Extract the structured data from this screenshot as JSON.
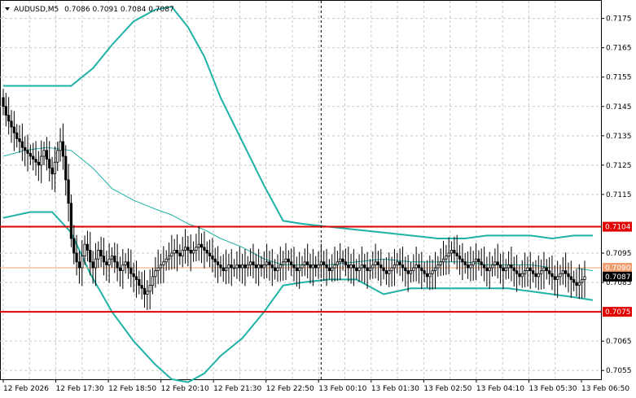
{
  "header": {
    "symbol": "AUDUSD,M5",
    "ohlc": "0.7086 0.7091 0.7084 0.7087"
  },
  "colors": {
    "grid": "#c8c8c8",
    "candle": "#000000",
    "bands": "#1fb2a6",
    "level_red": "#e00000",
    "level_orange": "#f0a070",
    "price_tag": "#000000"
  },
  "chart_data": {
    "type": "candlestick",
    "ylim": [
      0.7052,
      0.7181
    ],
    "y_ticks": [
      "0.7175",
      "0.7165",
      "0.7155",
      "0.7145",
      "0.7135",
      "0.7125",
      "0.7115",
      "0.7095",
      "0.7085",
      "0.7065",
      "0.7055"
    ],
    "x_ticks": [
      "12 Feb 2026",
      "12 Feb 17:30",
      "12 Feb 18:50",
      "12 Feb 20:10",
      "12 Feb 21:30",
      "12 Feb 22:50",
      "13 Feb 00:10",
      "13 Feb 01:30",
      "13 Feb 02:50",
      "13 Feb 04:10",
      "13 Feb 05:30",
      "13 Feb 06:50"
    ],
    "levels": [
      {
        "label": "0.7104",
        "value": 0.7104,
        "color": "#e00000"
      },
      {
        "label": "0.7090",
        "value": 0.709,
        "color": "#f0a070"
      },
      {
        "label": "0.7075",
        "value": 0.7075,
        "color": "#e00000"
      }
    ],
    "current_price": {
      "label": "0.7087",
      "value": 0.7087
    },
    "vertical_marker_index": 117,
    "close": [
      0.7145,
      0.7142,
      0.714,
      0.7138,
      0.7136,
      0.7134,
      0.7133,
      0.7131,
      0.713,
      0.7129,
      0.7128,
      0.7127,
      0.7126,
      0.7125,
      0.7128,
      0.713,
      0.7127,
      0.7124,
      0.7122,
      0.7126,
      0.713,
      0.7133,
      0.7128,
      0.712,
      0.7112,
      0.71,
      0.7095,
      0.7092,
      0.709,
      0.7094,
      0.7098,
      0.7096,
      0.7092,
      0.709,
      0.7093,
      0.7096,
      0.7094,
      0.7092,
      0.7091,
      0.7093,
      0.7094,
      0.7092,
      0.709,
      0.7089,
      0.7091,
      0.7092,
      0.709,
      0.7088,
      0.7087,
      0.7086,
      0.7084,
      0.7083,
      0.7081,
      0.7082,
      0.7084,
      0.7087,
      0.7089,
      0.709,
      0.7091,
      0.7092,
      0.7093,
      0.7094,
      0.7095,
      0.7096,
      0.7095,
      0.7094,
      0.7096,
      0.7097,
      0.7096,
      0.7095,
      0.7096,
      0.7097,
      0.7098,
      0.7097,
      0.7096,
      0.7095,
      0.7094,
      0.7093,
      0.7092,
      0.7091,
      0.709,
      0.7089,
      0.709,
      0.7091,
      0.709,
      0.709,
      0.7091,
      0.709,
      0.7091,
      0.709,
      0.7091,
      0.7092,
      0.7091,
      0.709,
      0.7091,
      0.709,
      0.7091,
      0.7092,
      0.7091,
      0.709,
      0.7089,
      0.709,
      0.7091,
      0.7092,
      0.7093,
      0.7092,
      0.7091,
      0.709,
      0.7089,
      0.709,
      0.7091,
      0.7092,
      0.7091,
      0.709,
      0.7091,
      0.709,
      0.7091,
      0.7092,
      0.7091,
      0.709,
      0.7089,
      0.709,
      0.7091,
      0.7092,
      0.7093,
      0.7092,
      0.7091,
      0.709,
      0.7091,
      0.709,
      0.7089,
      0.709,
      0.7091,
      0.709,
      0.7089,
      0.709,
      0.7091,
      0.7092,
      0.7091,
      0.709,
      0.7089,
      0.7088,
      0.7089,
      0.709,
      0.7091,
      0.7092,
      0.7091,
      0.709,
      0.7089,
      0.7088,
      0.7089,
      0.709,
      0.7091,
      0.709,
      0.7089,
      0.7088,
      0.7087,
      0.7088,
      0.7089,
      0.709,
      0.7091,
      0.7092,
      0.7093,
      0.7094,
      0.7095,
      0.7096,
      0.7095,
      0.7094,
      0.7093,
      0.7092,
      0.7091,
      0.709,
      0.7091,
      0.7092,
      0.7093,
      0.7092,
      0.7091,
      0.709,
      0.7089,
      0.709,
      0.7091,
      0.7092,
      0.7091,
      0.709,
      0.7089,
      0.709,
      0.7091,
      0.709,
      0.7089,
      0.7088,
      0.7087,
      0.7088,
      0.7089,
      0.709,
      0.7089,
      0.7088,
      0.7087,
      0.7088,
      0.7089,
      0.709,
      0.7089,
      0.7088,
      0.7087,
      0.7086,
      0.7087,
      0.7088,
      0.7089,
      0.7088,
      0.7087,
      0.7086,
      0.7085,
      0.7084,
      0.7085,
      0.7086,
      0.7087
    ],
    "upper_band": [
      [
        0,
        0.7152
      ],
      [
        10,
        0.7152
      ],
      [
        25,
        0.7152
      ],
      [
        33,
        0.7158
      ],
      [
        40,
        0.7166
      ],
      [
        48,
        0.7174
      ],
      [
        56,
        0.7178
      ],
      [
        62,
        0.7179
      ],
      [
        68,
        0.7172
      ],
      [
        74,
        0.7162
      ],
      [
        80,
        0.7148
      ],
      [
        88,
        0.7133
      ],
      [
        96,
        0.7118
      ],
      [
        103,
        0.7106
      ],
      [
        110,
        0.7105
      ],
      [
        120,
        0.7104
      ],
      [
        130,
        0.7103
      ],
      [
        140,
        0.7102
      ],
      [
        150,
        0.7101
      ],
      [
        160,
        0.71
      ],
      [
        170,
        0.71
      ],
      [
        178,
        0.7101
      ],
      [
        186,
        0.7101
      ],
      [
        194,
        0.7101
      ],
      [
        202,
        0.71
      ],
      [
        210,
        0.7101
      ],
      [
        217,
        0.7101
      ]
    ],
    "lower_band": [
      [
        0,
        0.7107
      ],
      [
        10,
        0.7109
      ],
      [
        18,
        0.7109
      ],
      [
        25,
        0.7102
      ],
      [
        32,
        0.7088
      ],
      [
        40,
        0.7075
      ],
      [
        48,
        0.7065
      ],
      [
        56,
        0.7057
      ],
      [
        62,
        0.7052
      ],
      [
        68,
        0.7051
      ],
      [
        74,
        0.7054
      ],
      [
        80,
        0.706
      ],
      [
        88,
        0.7066
      ],
      [
        96,
        0.7075
      ],
      [
        103,
        0.7084
      ],
      [
        110,
        0.7085
      ],
      [
        120,
        0.7086
      ],
      [
        130,
        0.7086
      ],
      [
        140,
        0.7081
      ],
      [
        150,
        0.7083
      ],
      [
        160,
        0.7083
      ],
      [
        170,
        0.7083
      ],
      [
        178,
        0.7083
      ],
      [
        186,
        0.7083
      ],
      [
        194,
        0.7082
      ],
      [
        202,
        0.7081
      ],
      [
        210,
        0.708
      ],
      [
        217,
        0.7079
      ]
    ],
    "middle_band": [
      [
        0,
        0.7128
      ],
      [
        8,
        0.713
      ],
      [
        16,
        0.7131
      ],
      [
        25,
        0.713
      ],
      [
        33,
        0.7124
      ],
      [
        40,
        0.7117
      ],
      [
        48,
        0.7113
      ],
      [
        56,
        0.711
      ],
      [
        62,
        0.7108
      ],
      [
        68,
        0.7105
      ],
      [
        74,
        0.7103
      ],
      [
        80,
        0.71
      ],
      [
        88,
        0.7097
      ],
      [
        96,
        0.7093
      ],
      [
        103,
        0.7091
      ],
      [
        110,
        0.7091
      ],
      [
        120,
        0.7091
      ],
      [
        130,
        0.7092
      ],
      [
        140,
        0.7093
      ],
      [
        150,
        0.7092
      ],
      [
        160,
        0.7092
      ],
      [
        170,
        0.7092
      ],
      [
        178,
        0.7091
      ],
      [
        186,
        0.7091
      ],
      [
        194,
        0.7091
      ],
      [
        202,
        0.709
      ],
      [
        210,
        0.709
      ],
      [
        217,
        0.7089
      ]
    ]
  }
}
